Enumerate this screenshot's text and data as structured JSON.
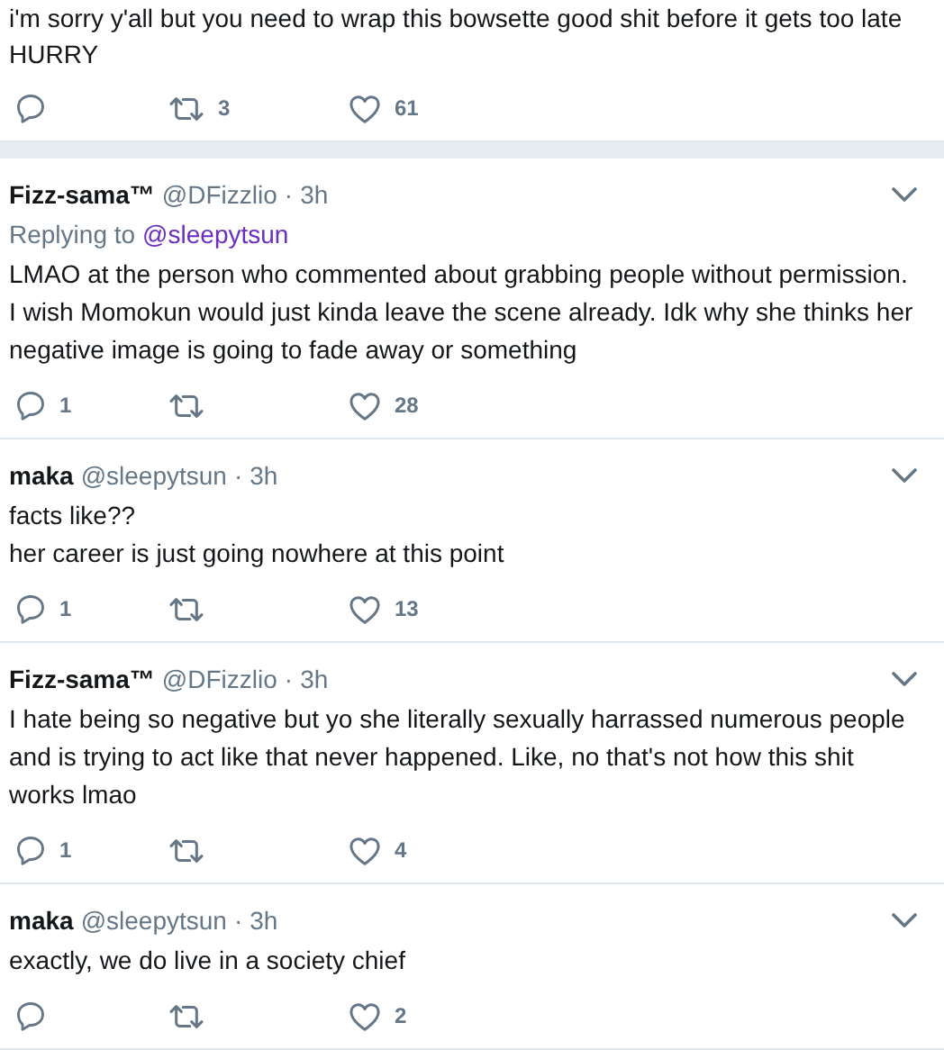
{
  "main_tweet": {
    "text": "i'm sorry y'all but you need to wrap this bowsette good shit before it gets too late\nHURRY",
    "retweets": "3",
    "likes": "61"
  },
  "replies": [
    {
      "name": "Fizz-sama™",
      "handle": "@DFizzlio",
      "separator": "·",
      "time": "3h",
      "replying_label": "Replying to",
      "replying_to": "@sleepytsun",
      "text": "LMAO at the person who commented about grabbing people without permission.\nI wish Momokun would just kinda leave the scene already. Idk why she thinks her\nnegative image is going to fade away or something",
      "replies": "1",
      "likes": "28"
    },
    {
      "name": "maka",
      "handle": "@sleepytsun",
      "separator": "·",
      "time": "3h",
      "text": "facts like??\nher career is just going nowhere at this point",
      "replies": "1",
      "likes": "13"
    },
    {
      "name": "Fizz-sama™",
      "handle": "@DFizzlio",
      "separator": "·",
      "time": "3h",
      "text": "I hate being so negative but yo she literally sexually harrassed numerous people\nand is trying to act like that never happened. Like, no that's not how this shit\nworks lmao",
      "replies": "1",
      "likes": "4"
    },
    {
      "name": "maka",
      "handle": "@sleepytsun",
      "separator": "·",
      "time": "3h",
      "text": "exactly, we do live in a society chief",
      "likes": "2"
    }
  ]
}
